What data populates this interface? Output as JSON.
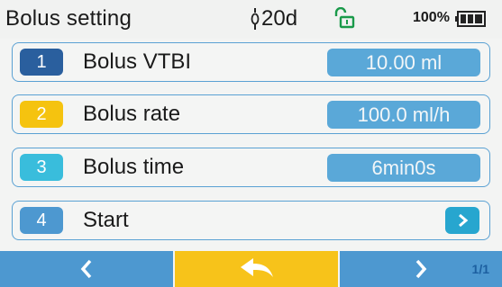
{
  "header": {
    "title": "Bolus setting",
    "duration": "20d",
    "battery_text": "100%"
  },
  "rows": [
    {
      "number": "1",
      "label": "Bolus VTBI",
      "value": "10.00 ml",
      "number_color": "#2a5f9e"
    },
    {
      "number": "2",
      "label": "Bolus rate",
      "value": "100.0 ml/h",
      "number_color": "#f5c30f"
    },
    {
      "number": "3",
      "label": "Bolus time",
      "value": "6min0s",
      "number_color": "#39bddc"
    },
    {
      "number": "4",
      "label": "Start",
      "number_color": "#4d98d0"
    }
  ],
  "footer": {
    "page_indicator": "1/1"
  },
  "icons": {
    "drip": "iv-drip-icon",
    "lock": "unlock-icon",
    "battery": "battery-icon",
    "prev": "chevron-left-icon",
    "back": "back-arrow-icon",
    "next": "chevron-right-icon",
    "start": "chevron-right-icon"
  },
  "colors": {
    "blue": "#4d98d0",
    "yellow": "#f7c31a",
    "lock_green": "#1a9a4a"
  }
}
